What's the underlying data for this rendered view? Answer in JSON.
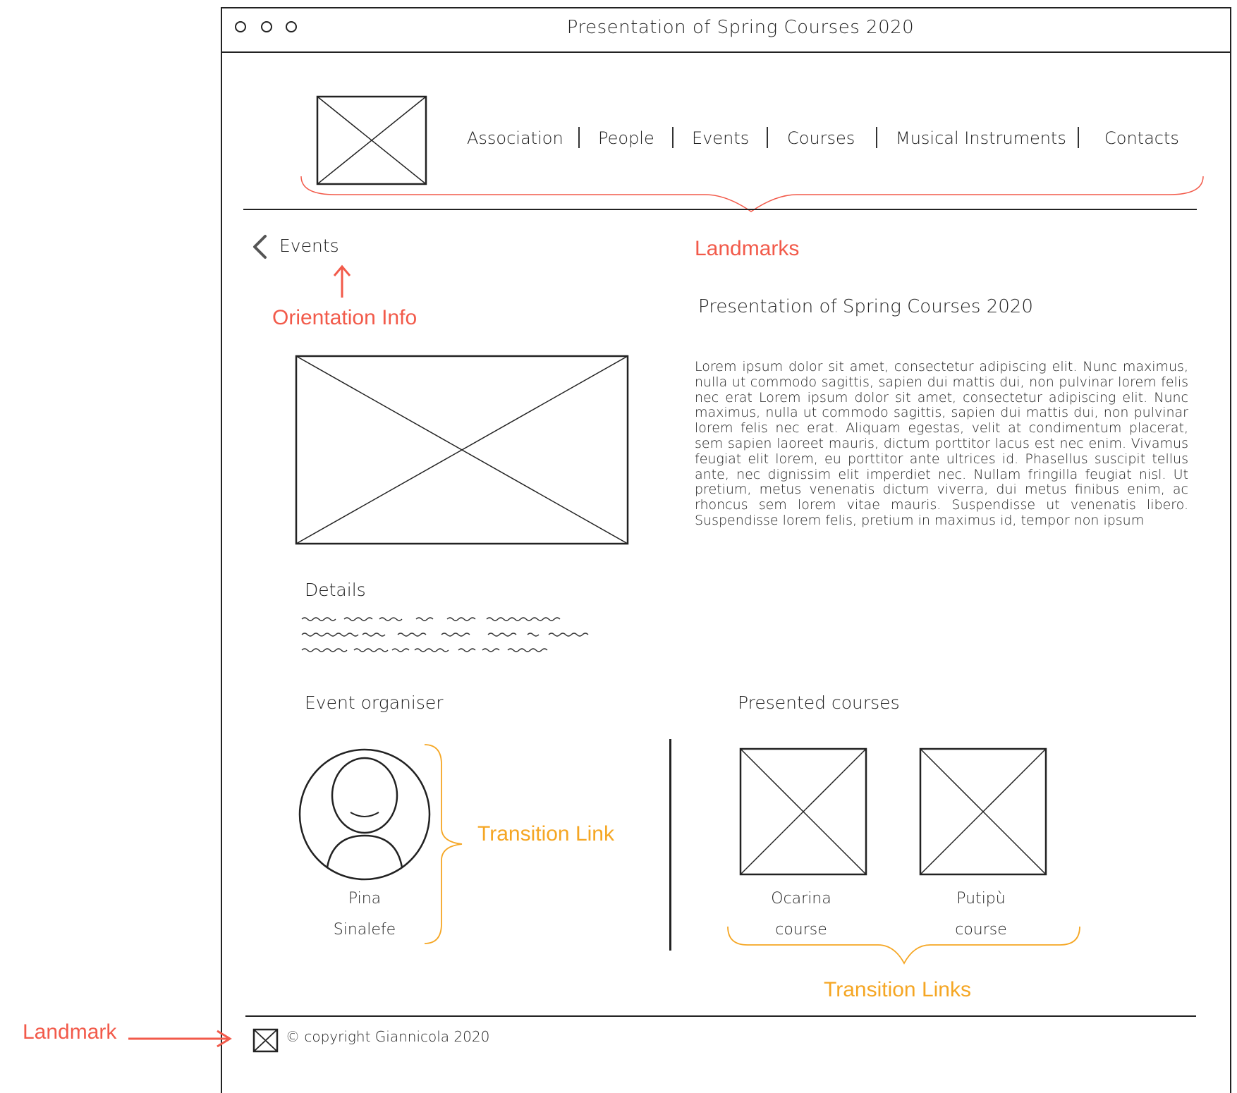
{
  "window": {
    "title": "Presentation of Spring Courses 2020",
    "control_dots": [
      "window-dot-1",
      "window-dot-2",
      "window-dot-3"
    ]
  },
  "nav": {
    "items": [
      {
        "label": "Association"
      },
      {
        "label": "People"
      },
      {
        "label": "Events"
      },
      {
        "label": "Courses"
      },
      {
        "label": "Musical Instruments"
      },
      {
        "label": "Contacts"
      }
    ]
  },
  "breadcrumb": {
    "label": "Events",
    "icon": "chevron-left-icon"
  },
  "article": {
    "title": "Presentation of Spring Courses 2020",
    "body": "Lorem ipsum dolor sit amet, consectetur adipiscing elit. Nunc maximus, nulla ut commodo sagittis, sapien dui mattis dui, non pulvinar lorem felis nec erat Lorem ipsum dolor sit amet, consectetur adipiscing elit. Nunc maximus, nulla ut commodo sagittis, sapien dui mattis dui, non pulvinar lorem felis nec erat. Aliquam egestas, velit at condimentum placerat, sem sapien laoreet mauris, dictum porttitor lacus est nec enim. Vivamus feugiat elit lorem, eu porttitor ante ultrices id. Phasellus suscipit tellus ante, nec dignissim elit imperdiet nec. Nullam fringilla feugiat nisl. Ut pretium, metus venenatis dictum viverra, dui metus finibus enim, ac rhoncus sem lorem vitae mauris. Suspendisse ut venenatis libero. Suspendisse lorem felis, pretium in maximus id, tempor non ipsum"
  },
  "details": {
    "heading": "Details"
  },
  "organiser": {
    "heading": "Event organiser",
    "first_name": "Pina",
    "last_name": "Sinalefe"
  },
  "courses": {
    "heading": "Presented courses",
    "items": [
      {
        "line1": "Ocarina",
        "line2": "course"
      },
      {
        "line1": "Putipù",
        "line2": "course"
      }
    ]
  },
  "footer": {
    "copyright": "© copyright Giannicola 2020"
  },
  "annotations": {
    "landmarks": "Landmarks",
    "orientation": "Orientation Info",
    "transition_link": "Transition Link",
    "transition_links": "Transition Links",
    "landmark": "Landmark"
  },
  "colors": {
    "annotation_red": "#f25a4a",
    "annotation_orange": "#f5a623",
    "ink": "#222222"
  }
}
